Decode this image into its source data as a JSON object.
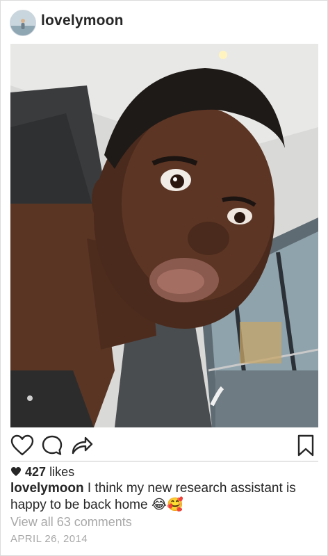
{
  "header": {
    "username": "lovelymoon",
    "avatar_icon": "profile-avatar"
  },
  "actions": {
    "like_icon": "heart-outline-icon",
    "comment_icon": "speech-bubble-icon",
    "share_icon": "share-arrow-icon",
    "save_icon": "bookmark-icon"
  },
  "likes": {
    "icon": "heart-filled-icon",
    "count": "427",
    "label": "likes"
  },
  "caption": {
    "username": "lovelymoon",
    "text": "I think my new research assistant is happy to be back home",
    "emoji": "😂🥰"
  },
  "comments": {
    "view_all": "View all 63 comments"
  },
  "post": {
    "date": "APRIL 26, 2014"
  },
  "colors": {
    "text": "#262626",
    "muted": "#a8a8a8",
    "border": "#dbdbdb"
  }
}
